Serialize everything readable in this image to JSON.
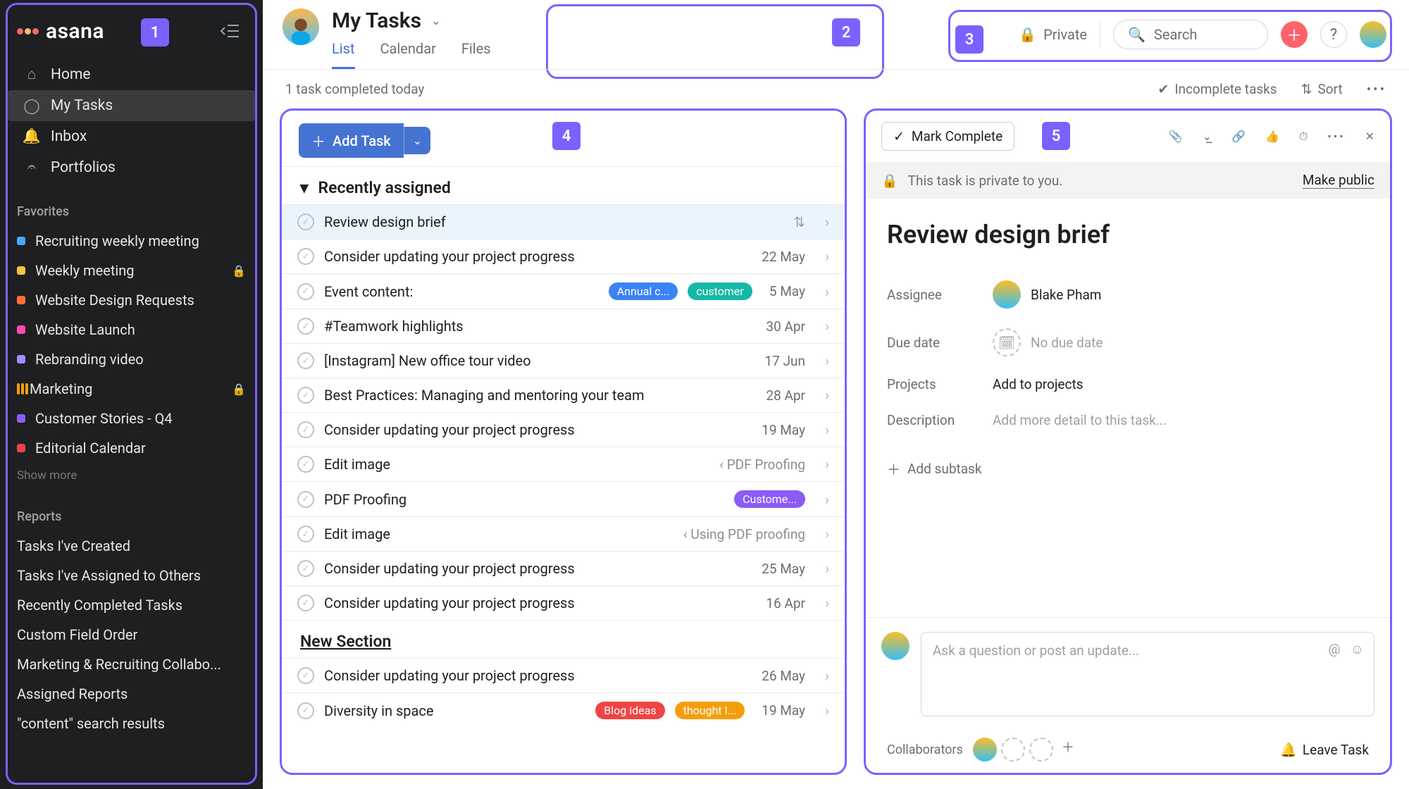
{
  "sidebar": {
    "logo_text": "asana",
    "nav": [
      {
        "label": "Home",
        "icon": "home"
      },
      {
        "label": "My Tasks",
        "icon": "check",
        "active": true
      },
      {
        "label": "Inbox",
        "icon": "bell"
      },
      {
        "label": "Portfolios",
        "icon": "bars"
      }
    ],
    "favorites_title": "Favorites",
    "favorites": [
      {
        "label": "Recruiting weekly meeting",
        "color": "#4aa7ff"
      },
      {
        "label": "Weekly meeting",
        "color": "#f6c344",
        "locked": true
      },
      {
        "label": "Website Design Requests",
        "color": "#ff6f3c"
      },
      {
        "label": "Website Launch",
        "color": "#ff4bb4"
      },
      {
        "label": "Rebranding video",
        "color": "#a78bfa"
      },
      {
        "label": "Marketing",
        "color": "#f59e0b",
        "bar": true,
        "locked": true
      },
      {
        "label": "Customer Stories - Q4",
        "color": "#8b5cf6"
      },
      {
        "label": "Editorial Calendar",
        "color": "#ef4444"
      }
    ],
    "show_more": "Show more",
    "reports_title": "Reports",
    "reports": [
      "Tasks I've Created",
      "Tasks I've Assigned to Others",
      "Recently Completed Tasks",
      "Custom Field Order",
      "Marketing & Recruiting Collabo...",
      "Assigned Reports",
      "\"content\" search results"
    ]
  },
  "callouts": {
    "c1": "1",
    "c2": "2",
    "c3": "3",
    "c4": "4",
    "c5": "5"
  },
  "header": {
    "title": "My Tasks",
    "tabs": [
      {
        "label": "List",
        "active": true
      },
      {
        "label": "Calendar"
      },
      {
        "label": "Files"
      }
    ],
    "private_label": "Private",
    "search_placeholder": "Search"
  },
  "subbar": {
    "status": "1 task completed today",
    "filter_label": "Incomplete tasks",
    "sort_label": "Sort"
  },
  "list": {
    "add_task_label": "Add Task",
    "section1": "Recently assigned",
    "section2": "New Section",
    "tasks": [
      {
        "title": "Review design brief",
        "selected": true,
        "move_icon": true
      },
      {
        "title": "Consider updating your project progress",
        "date": "22 May"
      },
      {
        "title": "Event content:",
        "date": "5 May",
        "tags": [
          {
            "text": "Annual c...",
            "bg": "#3b82f6"
          },
          {
            "text": "customer",
            "bg": "#14b8a6"
          }
        ]
      },
      {
        "title": "#Teamwork highlights",
        "date": "30 Apr"
      },
      {
        "title": "[Instagram] New office tour video",
        "date": "17 Jun"
      },
      {
        "title": "Best Practices: Managing and mentoring your team",
        "date": "28 Apr"
      },
      {
        "title": "Consider updating your project progress",
        "date": "19 May"
      },
      {
        "title": "Edit image",
        "crumb": "‹ PDF Proofing"
      },
      {
        "title": "PDF Proofing",
        "tags": [
          {
            "text": "Custome...",
            "bg": "#8b5cf6"
          }
        ]
      },
      {
        "title": "Edit image",
        "crumb": "‹ Using PDF proofing"
      },
      {
        "title": "Consider updating your project progress",
        "date": "25 May"
      },
      {
        "title": "Consider updating your project progress",
        "date": "16 Apr"
      }
    ],
    "tasks2": [
      {
        "title": "Consider updating your project progress",
        "date": "26 May"
      },
      {
        "title": "Diversity in space",
        "date": "19 May",
        "tags": [
          {
            "text": "Blog ideas",
            "bg": "#ef4444"
          },
          {
            "text": "thought l...",
            "bg": "#f59e0b"
          }
        ]
      }
    ]
  },
  "detail": {
    "mark_complete": "Mark Complete",
    "privacy_msg": "This task is private to you.",
    "make_public": "Make public",
    "title": "Review design brief",
    "fields": {
      "assignee_label": "Assignee",
      "assignee_value": "Blake Pham",
      "duedate_label": "Due date",
      "duedate_placeholder": "No due date",
      "projects_label": "Projects",
      "projects_placeholder": "Add to projects",
      "description_label": "Description",
      "description_placeholder": "Add more detail to this task..."
    },
    "add_subtask": "Add subtask",
    "comment_placeholder": "Ask a question or post an update...",
    "collaborators_label": "Collaborators",
    "leave_task": "Leave Task"
  }
}
